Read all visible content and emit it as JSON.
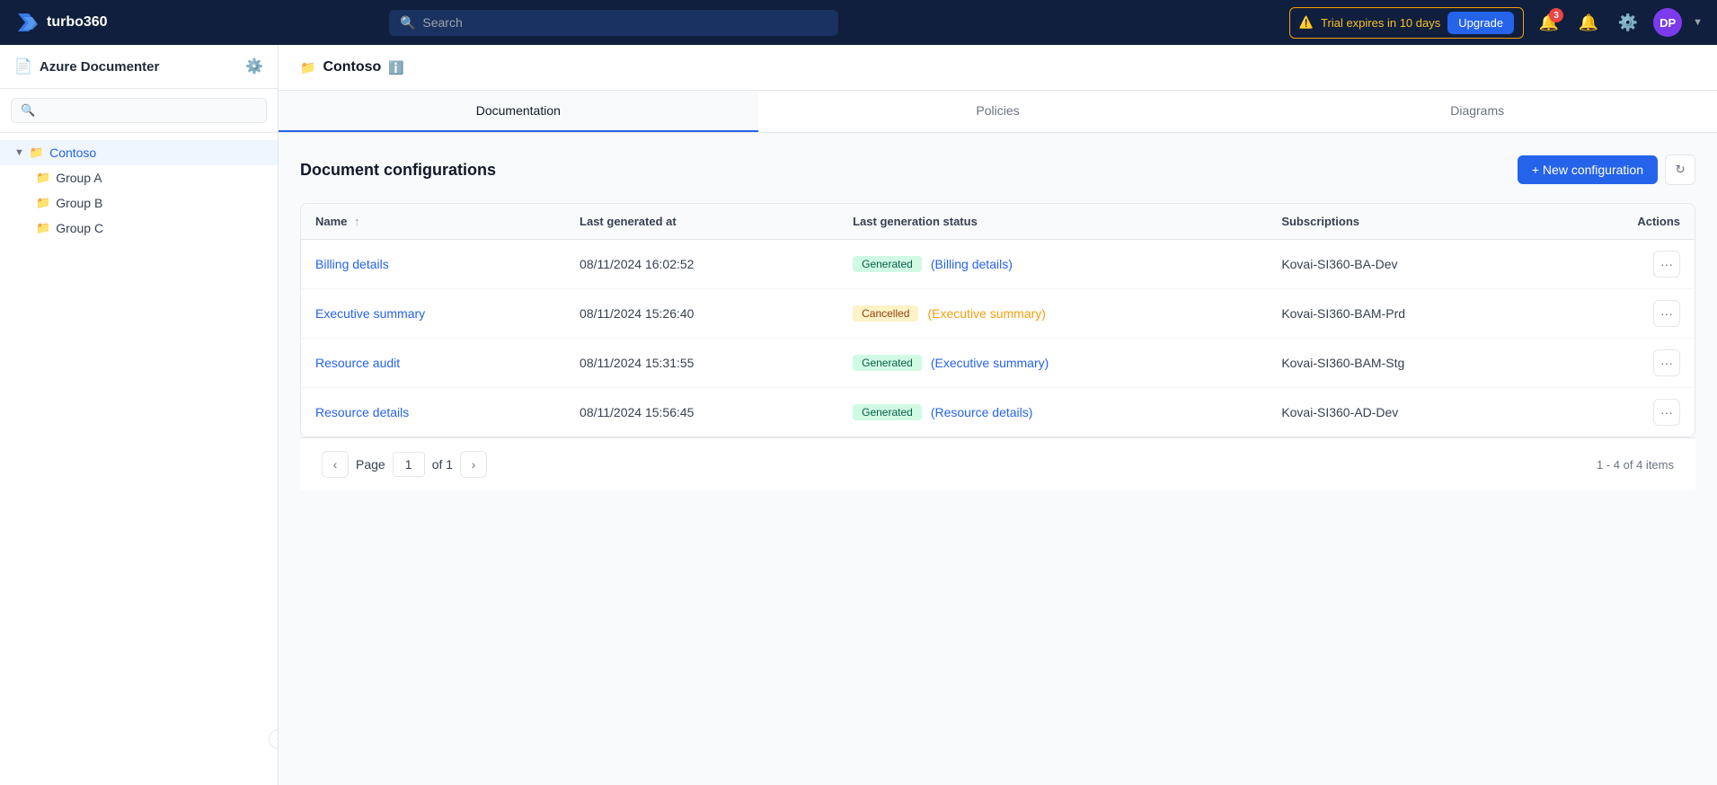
{
  "topnav": {
    "brand": "turbo360",
    "search_placeholder": "Search",
    "trial_text": "Trial expires in 10 days",
    "upgrade_label": "Upgrade",
    "notification_badge": "3",
    "avatar_initials": "DP"
  },
  "sidebar": {
    "app_name": "Azure Documenter",
    "search_placeholder": "",
    "tree": {
      "root": "Contoso",
      "children": [
        "Group A",
        "Group B",
        "Group C"
      ]
    }
  },
  "content_header": {
    "folder_name": "Contoso"
  },
  "tabs": [
    {
      "id": "documentation",
      "label": "Documentation",
      "active": true
    },
    {
      "id": "policies",
      "label": "Policies",
      "active": false
    },
    {
      "id": "diagrams",
      "label": "Diagrams",
      "active": false
    }
  ],
  "document_configs": {
    "title": "Document configurations",
    "new_config_label": "+ New configuration",
    "columns": {
      "name": "Name",
      "last_generated_at": "Last generated at",
      "last_generation_status": "Last generation status",
      "subscriptions": "Subscriptions",
      "actions": "Actions"
    },
    "rows": [
      {
        "name": "Billing details",
        "last_generated_at": "08/11/2024 16:02:52",
        "status": "Generated",
        "status_type": "generated",
        "status_link": "(Billing details)",
        "subscriptions": "Kovai-SI360-BA-Dev"
      },
      {
        "name": "Executive summary",
        "last_generated_at": "08/11/2024 15:26:40",
        "status": "Cancelled",
        "status_type": "cancelled",
        "status_link": "(Executive summary)",
        "subscriptions": "Kovai-SI360-BAM-Prd"
      },
      {
        "name": "Resource audit",
        "last_generated_at": "08/11/2024 15:31:55",
        "status": "Generated",
        "status_type": "generated",
        "status_link": "(Executive summary)",
        "subscriptions": "Kovai-SI360-BAM-Stg"
      },
      {
        "name": "Resource details",
        "last_generated_at": "08/11/2024 15:56:45",
        "status": "Generated",
        "status_type": "generated",
        "status_link": "(Resource details)",
        "subscriptions": "Kovai-SI360-AD-Dev"
      }
    ],
    "pagination": {
      "page_label": "Page",
      "current_page": "1",
      "of_label": "of 1",
      "items_summary": "1 - 4 of 4 items"
    }
  }
}
